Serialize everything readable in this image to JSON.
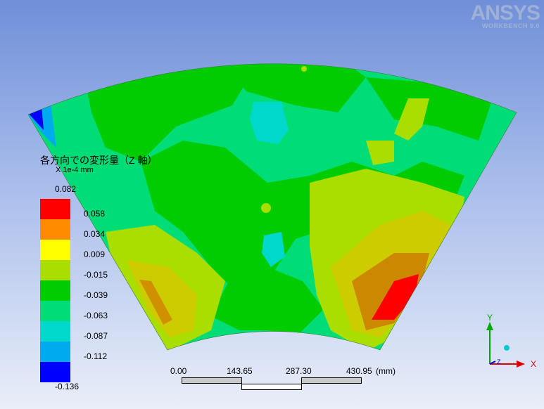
{
  "app": {
    "logo_text": "ANSYS",
    "logo_subtext": "WORKBENCH 9.0"
  },
  "legend": {
    "title": "各方向での変形量（Z 軸）",
    "unit": "X 1e-4 mm",
    "levels": [
      {
        "value": "0.082",
        "color": "#ff0000"
      },
      {
        "value": "0.058",
        "color": "#ff8c00"
      },
      {
        "value": "0.034",
        "color": "#ffff00"
      },
      {
        "value": "0.009",
        "color": "#aadd00"
      },
      {
        "value": "-0.015",
        "color": "#00cc00"
      },
      {
        "value": "-0.039",
        "color": "#00dd77"
      },
      {
        "value": "-0.063",
        "color": "#00d8cc"
      },
      {
        "value": "-0.087",
        "color": "#00aaee"
      },
      {
        "value": "-0.112",
        "color": "#0000ff"
      },
      {
        "value": "-0.136",
        "color": "#0000ff"
      }
    ]
  },
  "scale": {
    "ticks": [
      "0.00",
      "143.65",
      "287.30",
      "430.95"
    ],
    "unit": "(mm)"
  },
  "triad": {
    "x_label": "X",
    "y_label": "Y",
    "z_label": "Z"
  }
}
